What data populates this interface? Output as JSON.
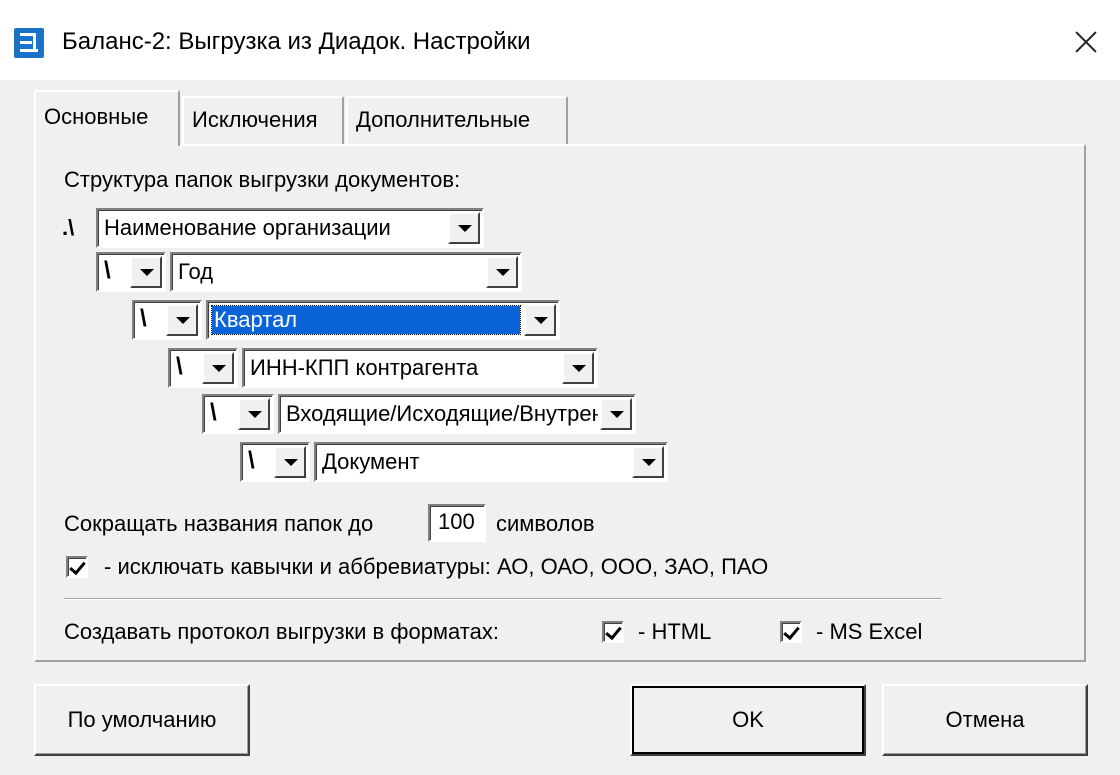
{
  "window": {
    "title": "Баланс-2: Выгрузка из Диадок. Настройки",
    "icon": "app-icon",
    "close_icon": "close-icon"
  },
  "tabs": [
    {
      "label": "Основные",
      "active": true
    },
    {
      "label": "Исключения",
      "active": false
    },
    {
      "label": "Дополнительные",
      "active": false
    }
  ],
  "main": {
    "structure_label": "Структура папок выгрузки документов:",
    "root_prefix": ".\\",
    "levels": [
      {
        "separator": "",
        "value": "Наименование организации",
        "selected": false
      },
      {
        "separator": "\\",
        "value": "Год",
        "selected": false
      },
      {
        "separator": "\\",
        "value": "Квартал",
        "selected": true
      },
      {
        "separator": "\\",
        "value": "ИНН-КПП контрагента",
        "selected": false
      },
      {
        "separator": "\\",
        "value": "Входящие/Исходящие/Внутренние",
        "selected": false
      },
      {
        "separator": "\\",
        "value": "Документ",
        "selected": false
      }
    ],
    "shorten_label": "Сокращать названия папок до",
    "shorten_value": "100",
    "shorten_suffix": "символов",
    "exclude_quotes_label": "- исключать кавычки и аббревиатуры: АО, ОАО, ООО, ЗАО, ПАО",
    "exclude_quotes_checked": true,
    "protocol_label": "Создавать протокол выгрузки в форматах:",
    "html_label": "- HTML",
    "html_checked": true,
    "excel_label": "- MS Excel",
    "excel_checked": true
  },
  "footer": {
    "defaults_label": "По умолчанию",
    "ok_label": "OK",
    "cancel_label": "Отмена"
  }
}
